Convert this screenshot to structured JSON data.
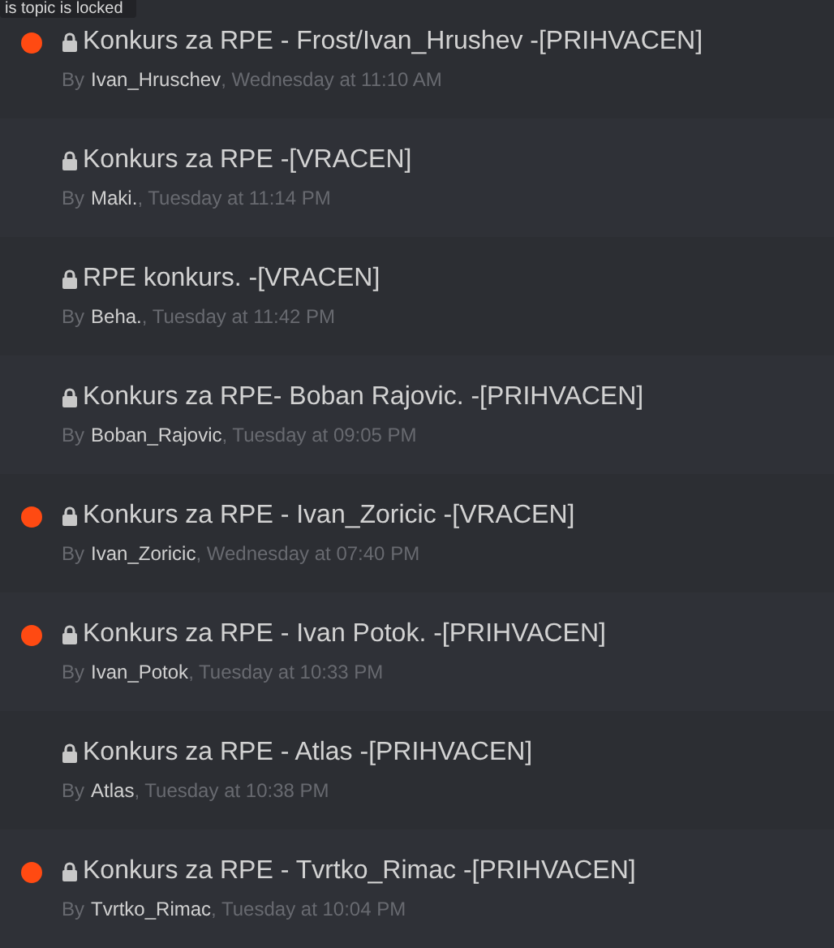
{
  "tooltip": {
    "text": "is topic is locked"
  },
  "topics": [
    {
      "title": "Konkurs za RPE - Frost/Ivan_Hrushev -[PRIHVACEN]",
      "unread": true,
      "locked": true,
      "by": "By",
      "author": "Ivan_Hruschev",
      "date": ", Wednesday at 11:10 AM"
    },
    {
      "title": "Konkurs za RPE -[VRACEN]",
      "unread": false,
      "locked": true,
      "by": "By",
      "author": "Maki.",
      "date": ", Tuesday at 11:14 PM"
    },
    {
      "title": "RPE konkurs. -[VRACEN]",
      "unread": false,
      "locked": true,
      "by": "By",
      "author": "Beha.",
      "date": ", Tuesday at 11:42 PM"
    },
    {
      "title": "Konkurs za RPE- Boban Rajovic. -[PRIHVACEN]",
      "unread": false,
      "locked": true,
      "by": "By",
      "author": "Boban_Rajovic",
      "date": ", Tuesday at 09:05 PM"
    },
    {
      "title": "Konkurs za RPE - Ivan_Zoricic -[VRACEN]",
      "unread": true,
      "locked": true,
      "by": "By",
      "author": "Ivan_Zoricic",
      "date": ", Wednesday at 07:40 PM"
    },
    {
      "title": "Konkurs za RPE - Ivan Potok. -[PRIHVACEN]",
      "unread": true,
      "locked": true,
      "by": "By",
      "author": "Ivan_Potok",
      "date": ", Tuesday at 10:33 PM"
    },
    {
      "title": "Konkurs za RPE - Atlas -[PRIHVACEN]",
      "unread": false,
      "locked": true,
      "by": "By",
      "author": "Atlas",
      "date": ", Tuesday at 10:38 PM"
    },
    {
      "title": "Konkurs za RPE - Tvrtko_Rimac -[PRIHVACEN]",
      "unread": true,
      "locked": true,
      "by": "By",
      "author": "Tvrtko_Rimac",
      "date": ", Tuesday at 10:04 PM"
    }
  ]
}
